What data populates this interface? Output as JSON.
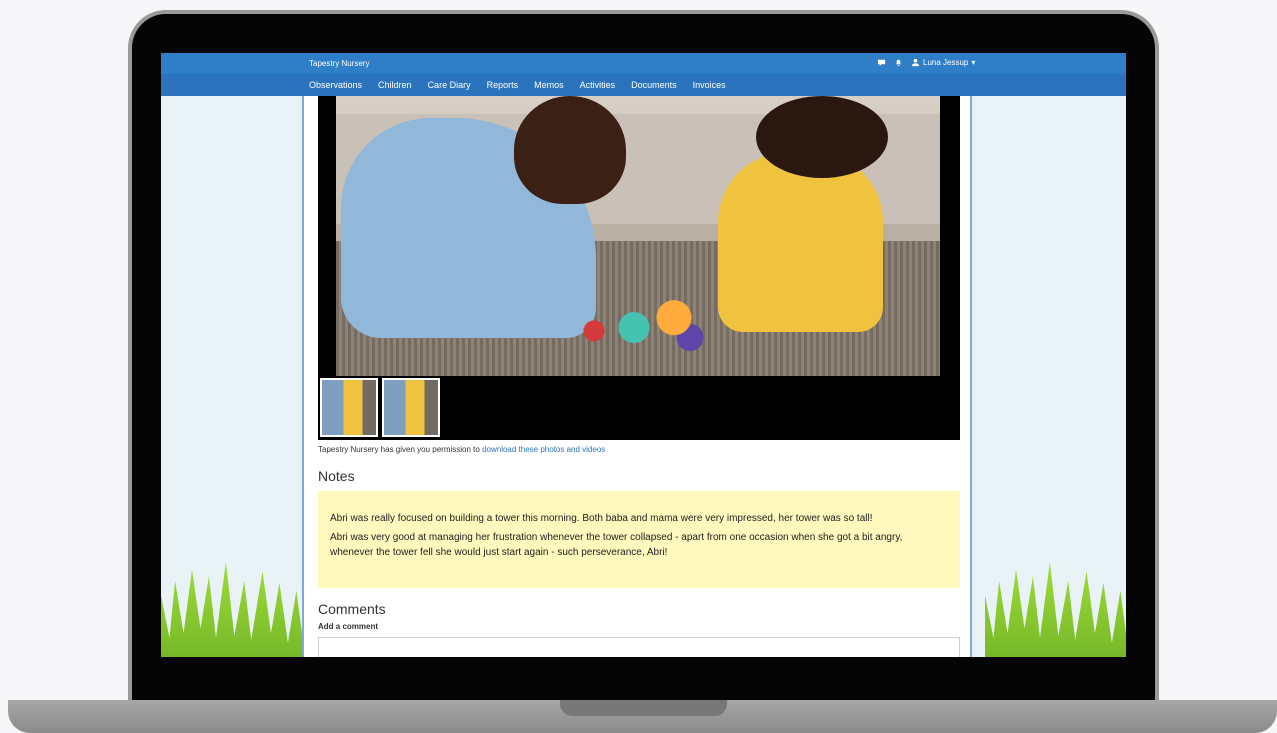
{
  "app": {
    "brand": "Tapestry Nursery"
  },
  "user": {
    "name": "Luna Jessup"
  },
  "nav": {
    "items": [
      "Observations",
      "Children",
      "Care Diary",
      "Reports",
      "Memos",
      "Activities",
      "Documents",
      "Invoices"
    ]
  },
  "media": {
    "permission_prefix": "Tapestry Nursery has given you permission to ",
    "permission_link": "download these photos and videos"
  },
  "notes": {
    "title": "Notes",
    "paragraphs": [
      "Abri was really focused on building a tower this morning. Both baba and mama were very impressed, her tower was so tall!",
      "Abri was very good at managing her frustration whenever the tower collapsed - apart from one occasion when she got a bit angry, whenever the tower fell she would just start again - such perseverance, Abri!"
    ]
  },
  "comments": {
    "title": "Comments",
    "add_label": "Add a comment"
  },
  "icons": {
    "chat": "chat-icon",
    "bell": "bell-icon",
    "user": "user-icon",
    "caret": "caret-down-icon"
  },
  "colors": {
    "header": "#2e7fc7",
    "nav": "#2b74bd",
    "notes_background": "#fff9bd",
    "link": "#2b74bd"
  }
}
